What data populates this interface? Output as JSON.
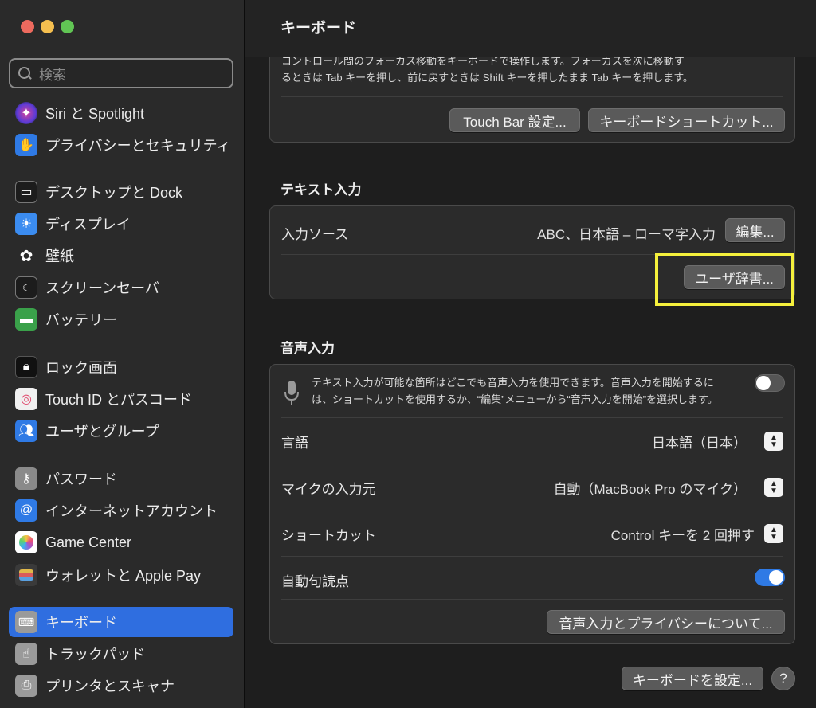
{
  "window": {
    "title": "キーボード"
  },
  "sidebar": {
    "search_placeholder": "検索",
    "items": [
      {
        "label": "Siri と Spotlight",
        "icon": "siri-icon",
        "color": "#7b4cc9"
      },
      {
        "label": "プライバシーとセキュリティ",
        "icon": "hand-icon",
        "color": "#2f7ae5"
      },
      {
        "label": "デスクトップと Dock",
        "icon": "dock-icon",
        "color": "#2b2b2b"
      },
      {
        "label": "ディスプレイ",
        "icon": "sun-icon",
        "color": "#3b8cf0"
      },
      {
        "label": "壁紙",
        "icon": "flower-icon",
        "color": "#2b2b2b"
      },
      {
        "label": "スクリーンセーバ",
        "icon": "screensaver-icon",
        "color": "#2f6fb0"
      },
      {
        "label": "バッテリー",
        "icon": "battery-icon",
        "color": "#3aa14a"
      },
      {
        "label": "ロック画面",
        "icon": "lock-icon",
        "color": "#1a1a1a"
      },
      {
        "label": "Touch ID とパスコード",
        "icon": "fingerprint-icon",
        "color": "#f0f0f0"
      },
      {
        "label": "ユーザとグループ",
        "icon": "users-icon",
        "color": "#2f7ae5"
      },
      {
        "label": "パスワード",
        "icon": "key-icon",
        "color": "#8a8a8a"
      },
      {
        "label": "インターネットアカウント",
        "icon": "at-icon",
        "color": "#2f7ae5"
      },
      {
        "label": "Game Center",
        "icon": "game-center-icon",
        "color": "#ffffff"
      },
      {
        "label": "ウォレットと Apple Pay",
        "icon": "wallet-icon",
        "color": "#3a3a3a"
      },
      {
        "label": "キーボード",
        "icon": "keyboard-icon",
        "color": "#9a9a9a"
      },
      {
        "label": "トラックパッド",
        "icon": "trackpad-icon",
        "color": "#9a9a9a"
      },
      {
        "label": "プリンタとスキャナ",
        "icon": "printer-icon",
        "color": "#9a9a9a"
      }
    ]
  },
  "main": {
    "top_panel": {
      "desc_line1": "コントロール間のフォーカス移動をキーボードで操作します。フォーカスを次に移動す",
      "desc_line2": "るときは Tab キーを押し、前に戻すときは Shift キーを押したまま Tab キーを押します。",
      "touchbar_button": "Touch Bar 設定...",
      "shortcuts_button": "キーボードショートカット..."
    },
    "text_input": {
      "title": "テキスト入力",
      "input_source_label": "入力ソース",
      "input_source_value": "ABC、日本語 – ローマ字入力",
      "edit_button": "編集...",
      "user_dict_button": "ユーザ辞書..."
    },
    "dictation": {
      "title": "音声入力",
      "desc_line1": "テキスト入力が可能な箇所はどこでも音声入力を使用できます。音声入力を開始するに",
      "desc_line2": "は、ショートカットを使用するか、“編集”メニューから“音声入力を開始”を選択します。",
      "enabled": false,
      "language_label": "言語",
      "language_value": "日本語（日本）",
      "mic_label": "マイクの入力元",
      "mic_value": "自動（MacBook Pro のマイク）",
      "shortcut_label": "ショートカット",
      "shortcut_value": "Control キーを 2 回押す",
      "auto_punct_label": "自動句読点",
      "auto_punct_enabled": true,
      "privacy_button": "音声入力とプライバシーについて..."
    },
    "setup_button": "キーボードを設定...",
    "help_label": "?"
  },
  "colors": {
    "accent": "#2f6ee0",
    "toggle_on": "#2f7ae5",
    "highlight": "#f5f03c",
    "close": "#ed6a5e",
    "minimize": "#f5bf4f",
    "zoom": "#61c554"
  }
}
